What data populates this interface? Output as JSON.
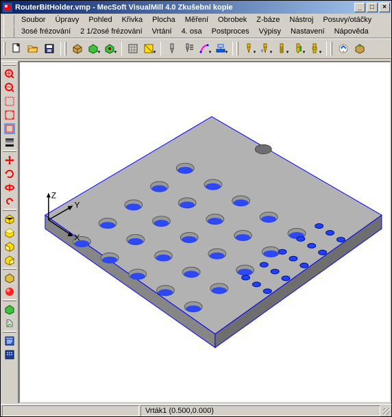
{
  "title": "RouterBitHolder.vmp - MecSoft  VisualMill 4.0 Zkušební kopie",
  "menu_row1": [
    "Soubor",
    "Úpravy",
    "Pohled",
    "Křivka",
    "Plocha",
    "Měření",
    "Obrobek",
    "Z-báze",
    "Nástroj",
    "Posuvy/otáčky"
  ],
  "menu_row2": [
    "3osé frézování",
    "2 1/2osé frézování",
    "Vrtání",
    "4. osa",
    "Postproces",
    "Výpisy",
    "Nastavení",
    "Nápověda"
  ],
  "axis": {
    "z": "Z",
    "y": "Y",
    "x": "X"
  },
  "status": "Vrták1 (0.500,0.000)"
}
